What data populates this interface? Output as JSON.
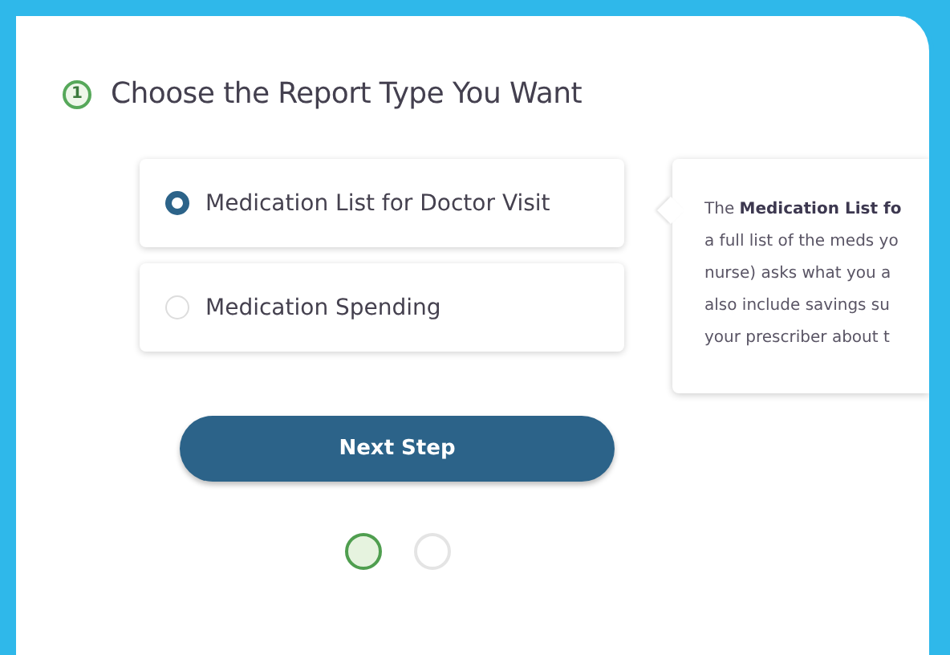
{
  "heading": {
    "step": "1",
    "title": "Choose the Report Type You Want"
  },
  "options": [
    {
      "label": "Medication List for Doctor Visit",
      "selected": true
    },
    {
      "label": "Medication Spending",
      "selected": false
    }
  ],
  "info_lines": [
    "The **Medication List fo**",
    "a full list of the meds yo",
    "nurse) asks what you a",
    "also include savings su",
    "your prescriber about t"
  ],
  "button": "Next Step",
  "steps": [
    {
      "selected": true
    },
    {
      "selected": false
    }
  ]
}
